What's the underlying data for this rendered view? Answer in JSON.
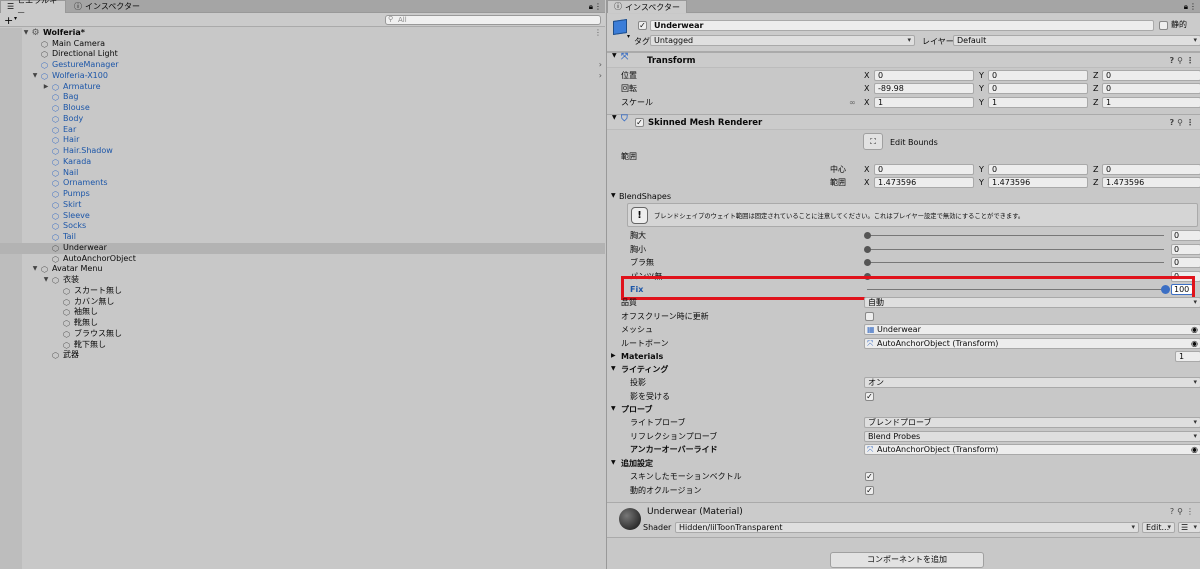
{
  "hierarchy": {
    "tab_label": "ヒエラルキー",
    "search_placeholder": "All",
    "scene_name": "Wolferia*",
    "items": [
      {
        "label": "Main Camera",
        "blue": false
      },
      {
        "label": "Directional Light",
        "blue": false
      },
      {
        "label": "GestureManager",
        "blue": true
      },
      {
        "label": "Wolferia-X100",
        "blue": true
      },
      {
        "label": "Armature",
        "blue": true
      },
      {
        "label": "Bag",
        "blue": true
      },
      {
        "label": "Blouse",
        "blue": true
      },
      {
        "label": "Body",
        "blue": true
      },
      {
        "label": "Ear",
        "blue": true
      },
      {
        "label": "Hair",
        "blue": true
      },
      {
        "label": "Hair.Shadow",
        "blue": true
      },
      {
        "label": "Karada",
        "blue": true
      },
      {
        "label": "Nail",
        "blue": true
      },
      {
        "label": "Ornaments",
        "blue": true
      },
      {
        "label": "Pumps",
        "blue": true
      },
      {
        "label": "Skirt",
        "blue": true
      },
      {
        "label": "Sleeve",
        "blue": true
      },
      {
        "label": "Socks",
        "blue": true
      },
      {
        "label": "Tail",
        "blue": true
      },
      {
        "label": "Underwear",
        "blue": false,
        "selected": true
      },
      {
        "label": "AutoAnchorObject",
        "blue": false
      },
      {
        "label": "Avatar Menu",
        "blue": false
      },
      {
        "label": "衣装",
        "blue": false
      },
      {
        "label": "スカート無し",
        "blue": false
      },
      {
        "label": "カバン無し",
        "blue": false
      },
      {
        "label": "袖無し",
        "blue": false
      },
      {
        "label": "靴無し",
        "blue": false
      },
      {
        "label": "ブラウス無し",
        "blue": false
      },
      {
        "label": "靴下無し",
        "blue": false
      },
      {
        "label": "武器",
        "blue": false
      }
    ]
  },
  "inspector_tab_label": "インスペクター",
  "inspector": {
    "tab_label": "インスペクター",
    "object_name": "Underwear",
    "static_label": "静的",
    "tag_label": "タグ",
    "tag_value": "Untagged",
    "layer_label": "レイヤー",
    "layer_value": "Default",
    "transform": {
      "title": "Transform",
      "position_label": "位置",
      "rotation_label": "回転",
      "scale_label": "スケール",
      "position": {
        "x": "0",
        "y": "0",
        "z": "0"
      },
      "rotation": {
        "x": "-89.98",
        "y": "0",
        "z": "0"
      },
      "scale": {
        "x": "1",
        "y": "1",
        "z": "1"
      }
    },
    "smr": {
      "title": "Skinned Mesh Renderer",
      "edit_bounds": "Edit Bounds",
      "bounds_label": "範囲",
      "center_label": "中心",
      "extent_label": "範囲",
      "center": {
        "x": "0",
        "y": "0",
        "z": "0"
      },
      "extent": {
        "x": "1.473596",
        "y": "1.473596",
        "z": "1.473596"
      },
      "blendshapes_label": "BlendShapes",
      "info_text": "ブレンドシェイプのウェイト範囲は固定されていることに注意してください。これはプレイヤー設定で無効にすることができます。",
      "shapes": [
        {
          "name": "胸大",
          "value": "0"
        },
        {
          "name": "胸小",
          "value": "0"
        },
        {
          "name": "ブラ無",
          "value": "0"
        },
        {
          "name": "パンツ無",
          "value": "0"
        },
        {
          "name": "Fix",
          "value": "100"
        }
      ],
      "quality_label": "品質",
      "quality_value": "自動",
      "offscreen_label": "オフスクリーン時に更新",
      "mesh_label": "メッシュ",
      "mesh_value": "Underwear",
      "rootbone_label": "ルートボーン",
      "rootbone_value": "AutoAnchorObject (Transform)",
      "materials_label": "Materials",
      "materials_count": "1",
      "lighting_label": "ライティング",
      "cast_label": "投影",
      "cast_value": "オン",
      "receive_label": "影を受ける",
      "probes_label": "プローブ",
      "lightprobe_label": "ライトプローブ",
      "lightprobe_value": "ブレンドプローブ",
      "reflprobe_label": "リフレクションプローブ",
      "reflprobe_value": "Blend Probes",
      "anchor_label": "アンカーオーバーライド",
      "anchor_value": "AutoAnchorObject (Transform)",
      "extra_label": "追加設定",
      "motion_label": "スキンしたモーションベクトル",
      "occlusion_label": "動的オクルージョン"
    },
    "material": {
      "title": "Underwear (Material)",
      "shader_label": "Shader",
      "shader_value": "Hidden/lilToonTransparent",
      "edit_label": "Edit..."
    },
    "add_component": "コンポーネントを追加"
  },
  "colors": {
    "highlight": "#e0121b",
    "link_blue": "#1c56a8"
  }
}
